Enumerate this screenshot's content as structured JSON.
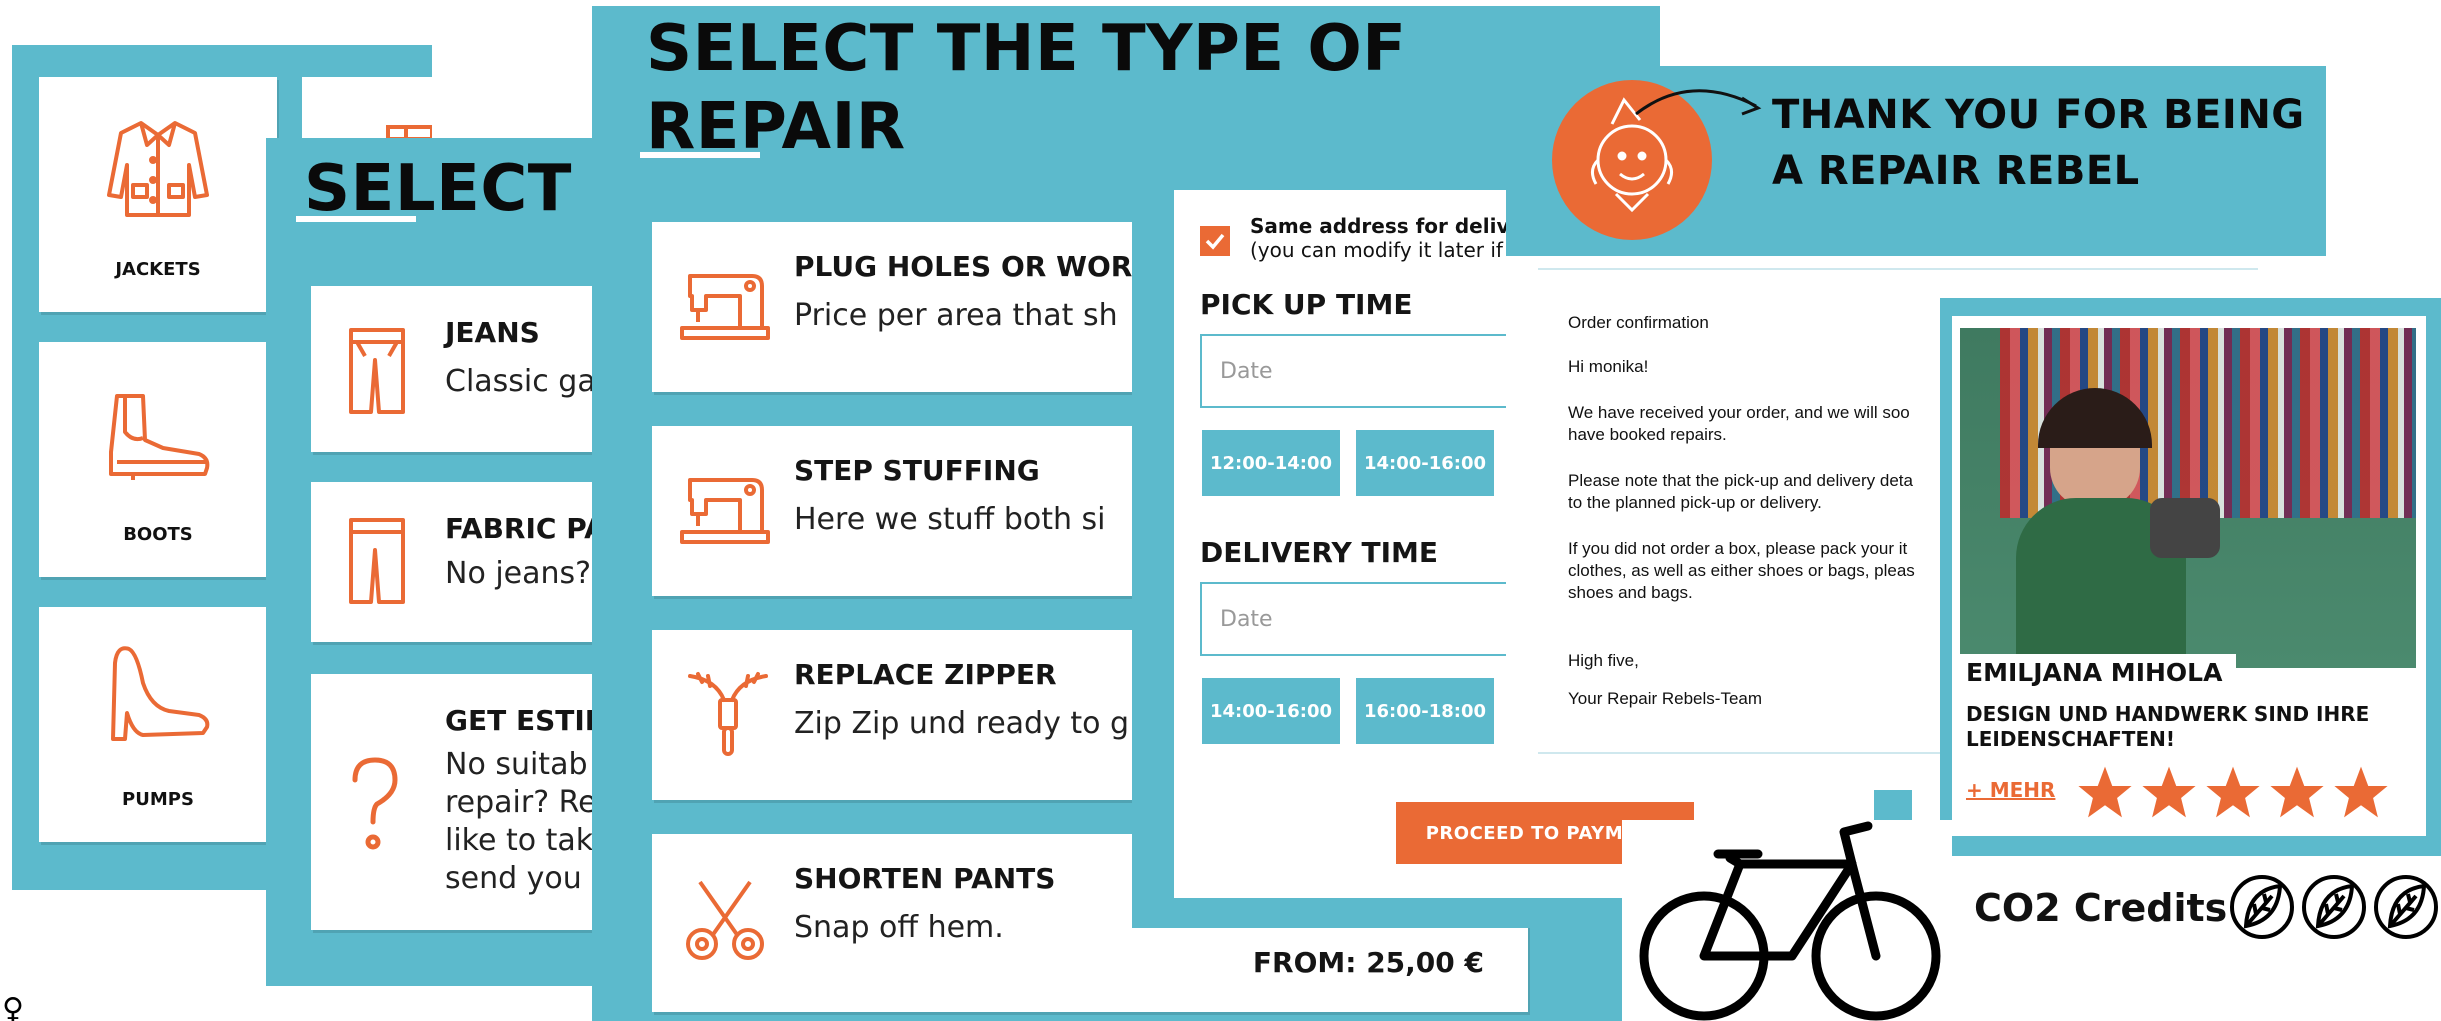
{
  "panel1": {
    "items": [
      {
        "label": "JACKETS",
        "icon": "jacket-icon"
      },
      {
        "label": "BOOTS",
        "icon": "boot-icon"
      },
      {
        "label": "PUMPS",
        "icon": "pump-icon"
      }
    ]
  },
  "panel2": {
    "heading": "SELECT T",
    "items": [
      {
        "title": "JEANS",
        "desc": "Classic ga",
        "icon": "jeans-icon"
      },
      {
        "title": "FABRIC PA",
        "desc": "No jeans?",
        "icon": "pants-icon"
      },
      {
        "title": "GET ESTIM",
        "desc_lines": [
          "No suitab",
          "repair? Re",
          "like to tak",
          "send you"
        ],
        "icon": "question-icon"
      }
    ]
  },
  "panel3": {
    "heading_line1": "SELECT THE TYPE OF",
    "heading_line2": "REPAIR",
    "items": [
      {
        "title": "PLUG HOLES OR WORN",
        "desc": "Price per area that sh",
        "icon": "sewing-machine-icon"
      },
      {
        "title": "STEP STUFFING",
        "desc": "Here we stuff both si",
        "icon": "sewing-machine-icon"
      },
      {
        "title": "REPLACE ZIPPER",
        "desc": "Zip Zip und ready to g",
        "icon": "zipper-icon"
      },
      {
        "title": "SHORTEN PANTS",
        "desc": "Snap off hem.",
        "icon": "scissors-icon"
      }
    ],
    "price": "FROM: 25,00 €"
  },
  "panel4": {
    "same_address_label": "Same address for delivery",
    "same_address_note": "(you can modify it later if",
    "pickup_heading": "PICK UP TIME",
    "pickup_placeholder": "Date",
    "pickup_slots": [
      "12:00-14:00",
      "14:00-16:00"
    ],
    "delivery_heading": "DELIVERY TIME",
    "delivery_placeholder": "Date",
    "delivery_slots": [
      "14:00-16:00",
      "16:00-18:00"
    ],
    "proceed_label": "PROCEED TO PAYMENT"
  },
  "panel5": {
    "heading_line1": "THANK YOU FOR BEING",
    "heading_line2": "A REPAIR REBEL",
    "mail": {
      "subject": "Order confirmation",
      "greeting": "Hi monika!",
      "p1": "We have received your order, and we will soo\nhave booked repairs.",
      "p2": "Please note that the pick-up and delivery deta\nto the planned pick-up or delivery.",
      "p3": "If you did not order a box, please pack your it\nclothes, as well as either shoes or bags, pleas\nshoes and bags.",
      "signoff": "High five,",
      "team": "Your Repair Rebels-Team"
    }
  },
  "profile": {
    "name": "EMILJANA MIHOLA",
    "tagline": "DESIGN UND HANDWERK SIND IHRE LEIDENSCHAFTEN!",
    "more_label": "+ MEHR",
    "rating": 5
  },
  "co2": {
    "label": "CO2 Credits",
    "leaf_count": 3
  },
  "colors": {
    "teal": "#5cbacc",
    "orange": "#ea6a35"
  }
}
